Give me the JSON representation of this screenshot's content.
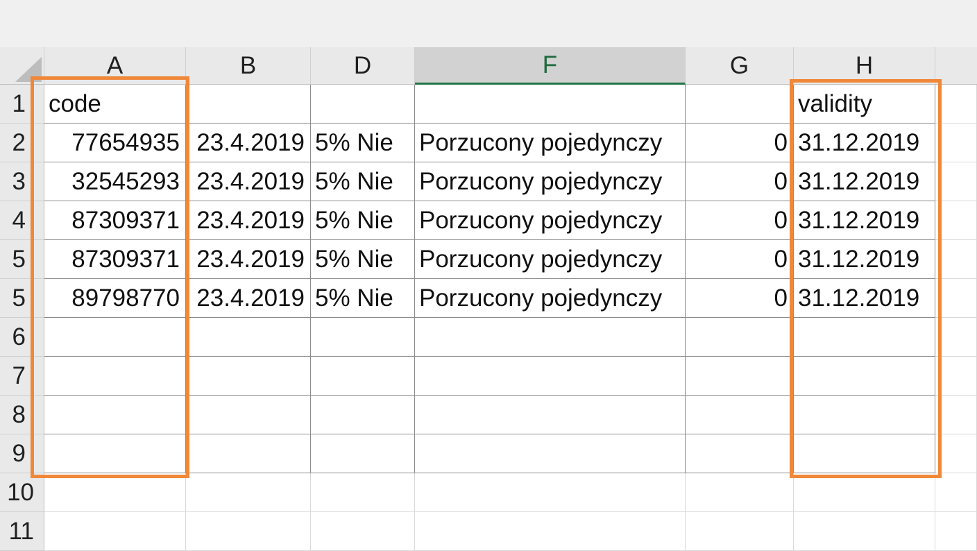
{
  "spreadsheet": {
    "columns": [
      "A",
      "B",
      "D",
      "F",
      "G",
      "H"
    ],
    "selected_column": "F",
    "row_labels": [
      "1",
      "2",
      "3",
      "4",
      "5",
      "5",
      "6",
      "7",
      "8",
      "9",
      "10",
      "11"
    ],
    "header_row": {
      "A": "code",
      "H": "validity"
    },
    "rows": [
      {
        "A": "77654935",
        "B": "23.4.2019",
        "D": "5% Nie",
        "F": "Porzucony pojedynczy",
        "G": "0",
        "H": "31.12.2019"
      },
      {
        "A": "32545293",
        "B": "23.4.2019",
        "D": "5% Nie",
        "F": "Porzucony pojedynczy",
        "G": "0",
        "H": "31.12.2019"
      },
      {
        "A": "87309371",
        "B": "23.4.2019",
        "D": "5% Nie",
        "F": "Porzucony pojedynczy",
        "G": "0",
        "H": "31.12.2019"
      },
      {
        "A": "87309371",
        "B": "23.4.2019",
        "D": "5% Nie",
        "F": "Porzucony pojedynczy",
        "G": "0",
        "H": "31.12.2019"
      },
      {
        "A": "89798770",
        "B": "23.4.2019",
        "D": "5% Nie",
        "F": "Porzucony pojedynczy",
        "G": "0",
        "H": "31.12.2019"
      }
    ]
  },
  "colors": {
    "highlight_box": "#f0883a",
    "selected_header_text": "#1d6b3c",
    "selected_header_underline": "#217346"
  }
}
